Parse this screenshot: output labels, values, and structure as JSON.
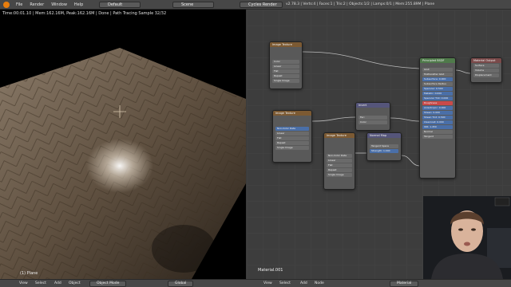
{
  "topbar": {
    "menus": [
      "File",
      "Render",
      "Window",
      "Help"
    ],
    "layout": "Default",
    "scene": "Scene",
    "engine": "Cycles Render",
    "stats": "v2.78.3 | Verts:4 | Faces:1 | Tris:2 | Objects:1/2 | Lamps:0/1 | Mem:255.89M | Plane"
  },
  "viewport": {
    "info": "Time:00:01.10 | Mem:162.16M, Peak:162.16M | Done | Path Tracing Sample 32/32",
    "object_label": "(1) Plane"
  },
  "nodes": {
    "image_texture_top": {
      "title": "Image Texture",
      "rows": [
        "Color",
        "Linear",
        "Flat",
        "Repeat",
        "Single Image"
      ]
    },
    "image_texture_mid": {
      "title": "Image Texture",
      "rows": [
        "Non-Color Data",
        "Linear",
        "Flat",
        "Repeat",
        "Single Image"
      ]
    },
    "image_texture_low": {
      "title": "Image Texture",
      "rows": [
        "Non-Color Data",
        "Linear",
        "Flat",
        "Repeat",
        "Single Image"
      ]
    },
    "invert": {
      "title": "Invert",
      "rows": [
        "Fac:",
        "Color"
      ]
    },
    "normal_map": {
      "title": "Normal Map",
      "rows": [
        "Tangent Space",
        "Strength: 1.000"
      ]
    },
    "principled": {
      "title": "Principled BSDF",
      "rows": [
        "GGX",
        "Multiscatter GGX",
        "Subsurface: 0.000",
        "Subsurface Radius",
        "Specular: 0.500",
        "Metallic: 0.000",
        "Specular Tint: 0.000",
        "Roughness",
        "Anisotropic: 0.000",
        "Sheen: 0.000",
        "Sheen Tint: 0.500",
        "Clearcoat: 0.000",
        "IOR: 1.450",
        "Normal",
        "Tangent"
      ]
    },
    "output": {
      "title": "Material Output",
      "rows": [
        "Surface",
        "Volume",
        "Displacement"
      ]
    }
  },
  "material_name": "Material.001",
  "bottombar": {
    "left_items": [
      "View",
      "Select",
      "Add",
      "Object"
    ],
    "mode": "Object Mode",
    "pivot": "Global",
    "right_items": [
      "View",
      "Select",
      "Add",
      "Node"
    ],
    "node_tree": "Material"
  },
  "colors": {
    "accent": "#e87d0d",
    "shader_header": "#4f7a4a",
    "texture_header": "#7c5a33"
  }
}
